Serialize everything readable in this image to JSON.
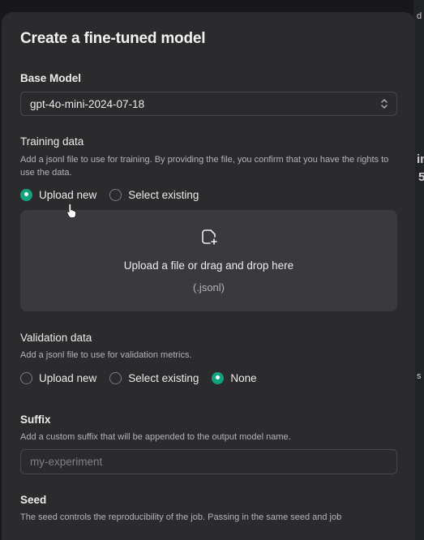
{
  "background": {
    "fragments": [
      "in",
      "5",
      "d",
      "s"
    ]
  },
  "modal": {
    "title": "Create a fine-tuned model",
    "base_model": {
      "label": "Base Model",
      "value": "gpt-4o-mini-2024-07-18"
    },
    "training_data": {
      "label": "Training data",
      "help": "Add a jsonl file to use for training. By providing the file, you confirm that you have the rights to use the data.",
      "options": [
        {
          "label": "Upload new",
          "checked": true
        },
        {
          "label": "Select existing",
          "checked": false
        }
      ],
      "dropzone": {
        "text": "Upload a file or drag and drop here",
        "subtext": "(.jsonl)"
      }
    },
    "validation_data": {
      "label": "Validation data",
      "help": "Add a jsonl file to use for validation metrics.",
      "options": [
        {
          "label": "Upload new",
          "checked": false
        },
        {
          "label": "Select existing",
          "checked": false
        },
        {
          "label": "None",
          "checked": true
        }
      ]
    },
    "suffix": {
      "label": "Suffix",
      "help": "Add a custom suffix that will be appended to the output model name.",
      "placeholder": "my-experiment"
    },
    "seed": {
      "label": "Seed",
      "help": "The seed controls the reproducibility of the job. Passing in the same seed and job"
    }
  },
  "colors": {
    "accent": "#10a37f",
    "modal_bg": "#2b2b2e",
    "dropzone_bg": "#3a3a3e"
  }
}
